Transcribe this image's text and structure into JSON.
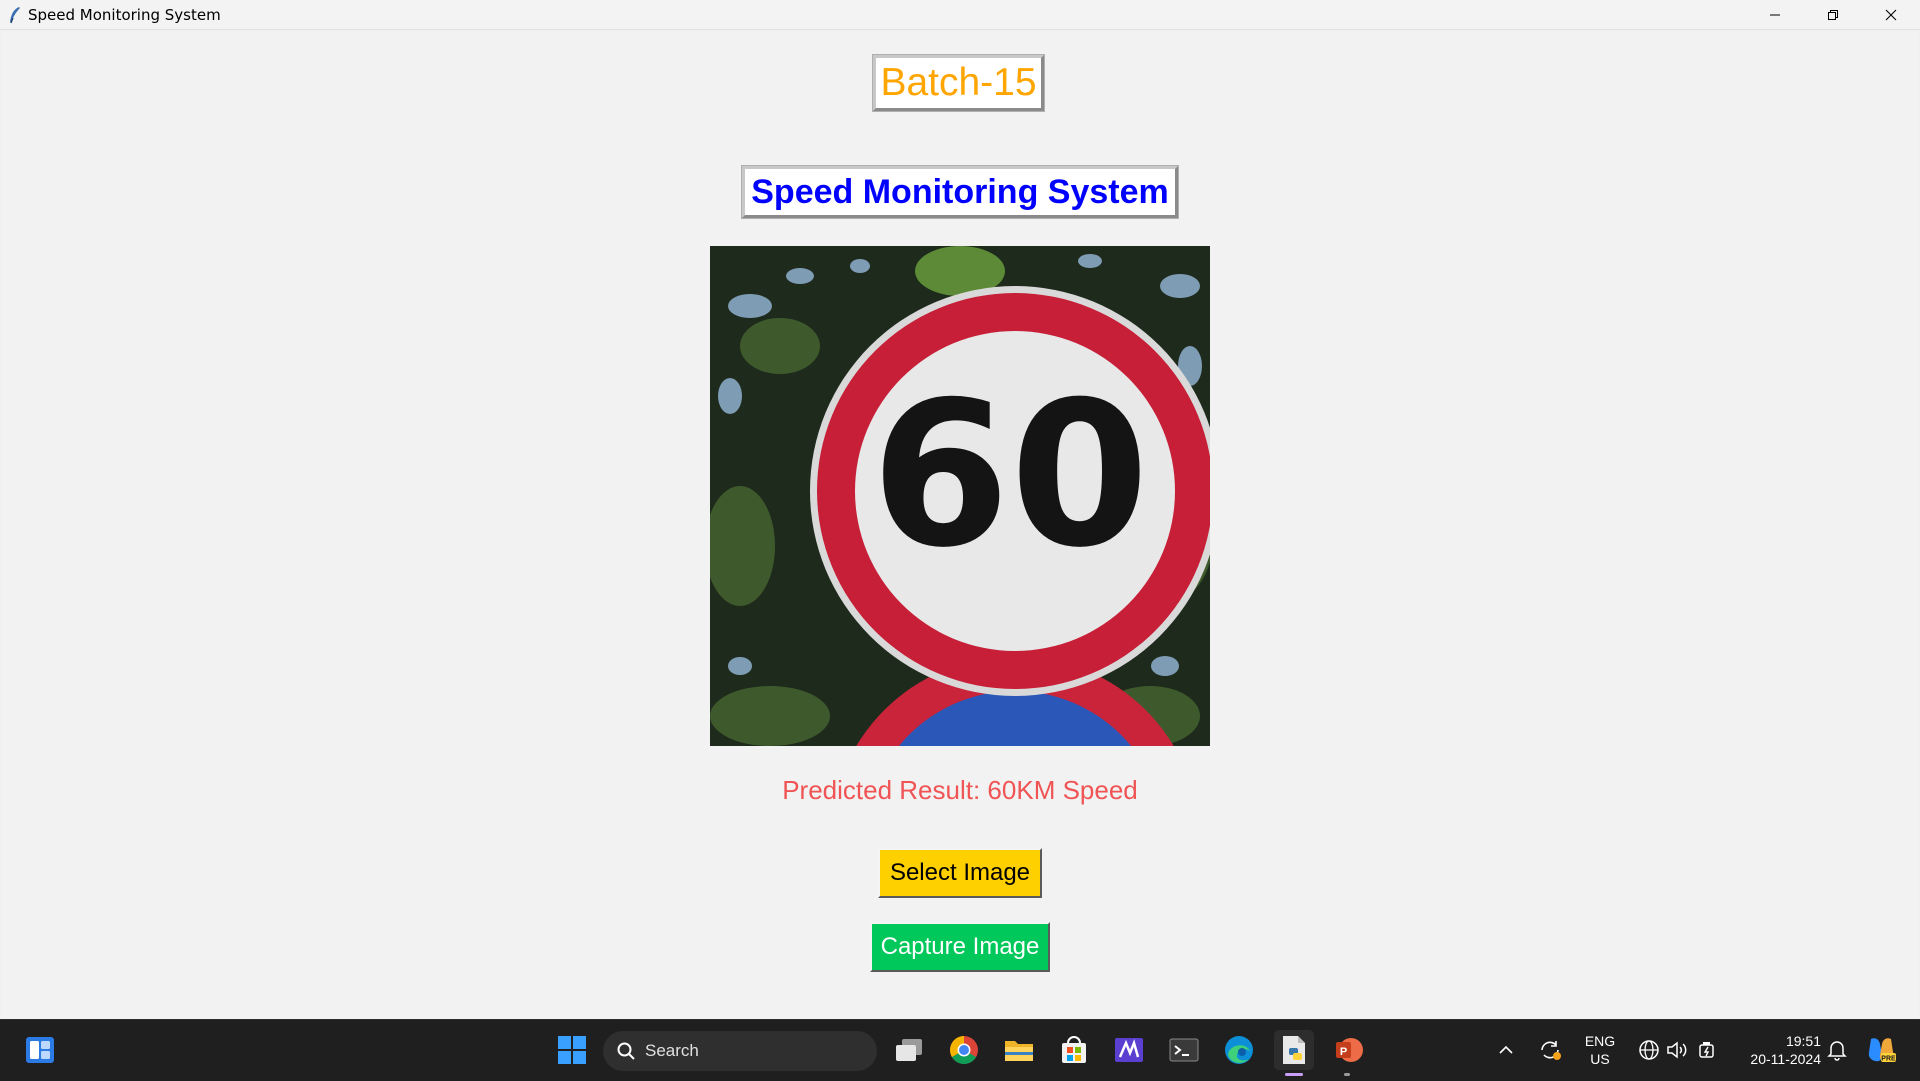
{
  "window": {
    "title": "Speed Monitoring System"
  },
  "app": {
    "batch_label": "Batch-15",
    "title": "Speed Monitoring System",
    "sign_value": "60",
    "result": "Predicted Result: 60KM Speed",
    "select_button": "Select Image",
    "capture_button": "Capture Image"
  },
  "colors": {
    "batch": "#ffa500",
    "title": "#0000ff",
    "result": "#f05454",
    "select_button_bg": "#ffd000",
    "capture_button_bg": "#00c85a"
  },
  "taskbar": {
    "search_placeholder": "Search",
    "language_line1": "ENG",
    "language_line2": "US",
    "time": "19:51",
    "date": "20-11-2024",
    "pinned": [
      "task-view",
      "chrome",
      "file-explorer",
      "microsoft-store",
      "visual-studio",
      "terminal",
      "edge",
      "python-idle",
      "powerpoint"
    ]
  }
}
